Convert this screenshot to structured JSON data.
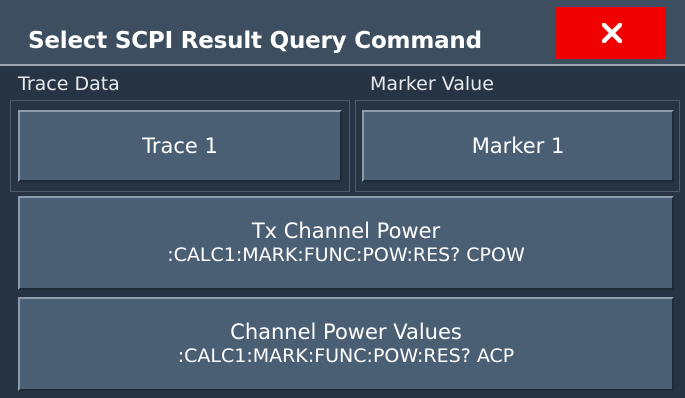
{
  "dialog": {
    "title": "Select SCPI Result Query Command",
    "close_icon": "close-x-icon"
  },
  "trace_data": {
    "label": "Trace Data",
    "button_label": "Trace 1"
  },
  "marker_value": {
    "label": "Marker Value",
    "button_label": "Marker 1"
  },
  "commands": [
    {
      "name": "Tx Channel Power",
      "command": ":CALC1:MARK:FUNC:POW:RES? CPOW"
    },
    {
      "name": "Channel Power Values",
      "command": ":CALC1:MARK:FUNC:POW:RES? ACP"
    }
  ],
  "colors": {
    "background": "#263443",
    "titlebar": "#3d4e60",
    "button": "#4a5f74",
    "close_button": "#f00000",
    "text": "#ffffff"
  }
}
